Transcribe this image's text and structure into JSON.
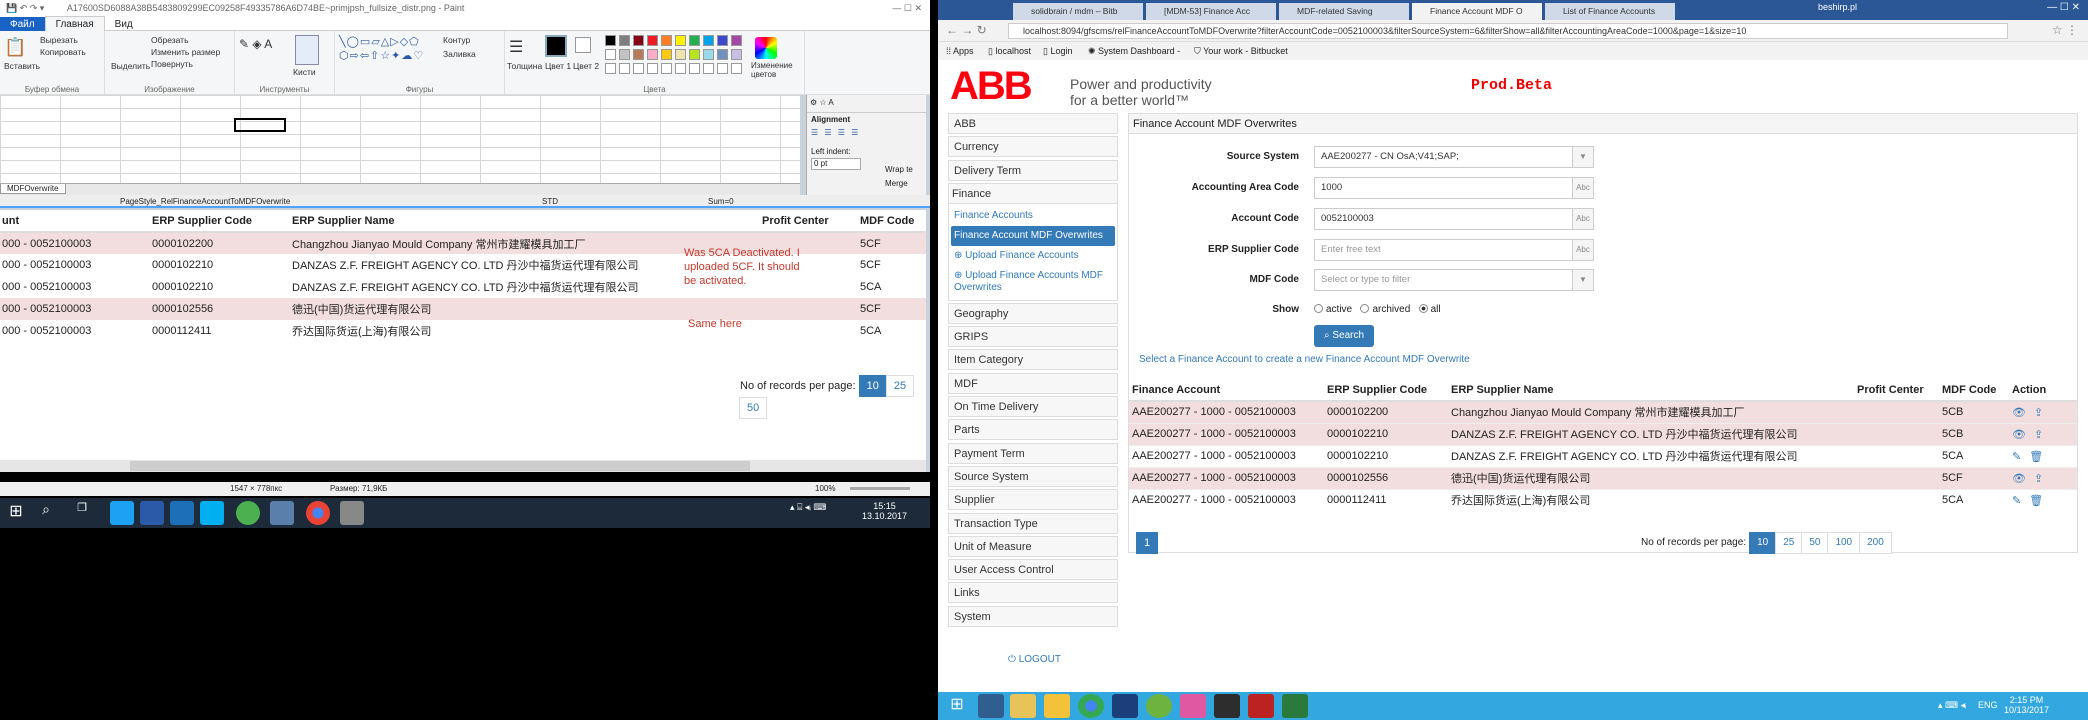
{
  "paint": {
    "title": "A17600SD6088A38B5483809299EC09258F49335786A6D74BE~primjpsh_fullsize_distr.png - Paint",
    "tabs": [
      "Файл",
      "Главная",
      "Вид"
    ],
    "ribbon": {
      "paste": "Вставить",
      "cut": "Вырезать",
      "copy": "Копировать",
      "select": "Выделить",
      "crop": "Обрезать",
      "resize": "Изменить размер",
      "rotate": "Повернуть",
      "brushes": "Кисти",
      "outline": "Контур",
      "fill": "Заливка",
      "size": "Толщина",
      "color1": "Цвет 1",
      "color2": "Цвет 2",
      "edit_colors": "Изменение цветов",
      "groups": [
        "Буфер обмена",
        "Изображение",
        "Инструменты",
        "Фигуры",
        "Цвета"
      ]
    },
    "sheet_tab": "MDFOverwrite",
    "page_style": "PageStyle_RelFinanceAccountToMDFOverwrite",
    "std": "STD",
    "sum": "Sum=0",
    "align_panel": {
      "title": "Alignment",
      "left_indent": "Left indent:",
      "indent_val": "0 pt",
      "wrap": "Wrap te",
      "merge": "Merge"
    },
    "table": {
      "headers": [
        "unt",
        "ERP Supplier Code",
        "ERP Supplier Name",
        "Profit Center",
        "MDF Code"
      ],
      "rows": [
        {
          "acct": "000 - 0052100003",
          "code": "0000102200",
          "name": "Changzhou Jianyao Mould Company 常州市建耀模具加工厂",
          "mdf": "5CF",
          "pink": true
        },
        {
          "acct": "000 - 0052100003",
          "code": "0000102210",
          "name": "DANZAS Z.F. FREIGHT AGENCY CO. LTD 丹沙中福货运代理有限公司",
          "mdf": "5CF",
          "pink": false
        },
        {
          "acct": "000 - 0052100003",
          "code": "0000102210",
          "name": "DANZAS Z.F. FREIGHT AGENCY CO. LTD 丹沙中福货运代理有限公司",
          "mdf": "5CA",
          "pink": false
        },
        {
          "acct": "000 - 0052100003",
          "code": "0000102556",
          "name": "德迅(中国)货运代理有限公司",
          "mdf": "5CF",
          "pink": true
        },
        {
          "acct": "000 - 0052100003",
          "code": "0000112411",
          "name": "乔达国际货运(上海)有限公司",
          "mdf": "5CA",
          "pink": false
        }
      ],
      "note1": "Was 5CA Deactivated. I uploaded 5CF. It should be activated.",
      "note2": "Same here",
      "records_label": "No of records per page:",
      "pages": [
        "10",
        "25",
        "50"
      ]
    },
    "status": {
      "dims": "1547 × 778пкс",
      "size": "Размер: 71,9КБ",
      "zoom": "100%"
    },
    "clock": {
      "time": "15:15",
      "date": "13.10.2017"
    }
  },
  "browser": {
    "tabs": [
      "solidbrain / mdm – Bitb",
      "[MDM-53] Finance Acc",
      "MDF-related Saving",
      "Finance Account MDF O",
      "List of Finance Accounts"
    ],
    "user": "beshirp.pl",
    "url": "localhost:8094/gfscms/relFinanceAccountToMDFOverwrite?filterAccountCode=0052100003&filterSourceSystem=6&filterShow=all&filterAccountingAreaCode=1000&page=1&size=10",
    "bookmarks": [
      "Apps",
      "localhost",
      "Login",
      "System Dashboard -",
      "Your work - Bitbucket"
    ],
    "logo": "ABB",
    "tagline1": "Power and productivity",
    "tagline2": "for a better world™",
    "env": "Prod.Beta",
    "nav_top": [
      "ABB",
      "Currency",
      "Delivery Term"
    ],
    "nav_group": {
      "header": "Finance",
      "items": [
        "Finance Accounts",
        "Finance Account MDF Overwrites",
        "Upload Finance Accounts",
        "Upload Finance Accounts MDF Overwrites"
      ]
    },
    "nav_bottom": [
      "Geography",
      "GRIPS",
      "Item Category",
      "MDF",
      "On Time Delivery",
      "Parts",
      "Payment Term",
      "Source System",
      "Supplier",
      "Transaction Type",
      "Unit of Measure",
      "User Access Control",
      "Links",
      "System"
    ],
    "logout": "LOGOUT",
    "panel_title": "Finance Account MDF Overwrites",
    "form": {
      "source_label": "Source System",
      "source_val": "AAE200277 - CN OsA;V41;SAP;",
      "area_label": "Accounting Area Code",
      "area_val": "1000",
      "account_label": "Account Code",
      "account_val": "0052100003",
      "erp_label": "ERP Supplier Code",
      "erp_ph": "Enter free text",
      "mdf_label": "MDF Code",
      "mdf_ph": "Select or type to filter",
      "show_label": "Show",
      "show_opts": [
        "active",
        "archived",
        "all"
      ],
      "search": "Search",
      "abc": "Abc"
    },
    "hint": "Select a Finance Account to create a new Finance Account MDF Overwrite",
    "table": {
      "headers": [
        "Finance Account",
        "ERP Supplier Code",
        "ERP Supplier Name",
        "Profit Center",
        "MDF Code",
        "Action"
      ],
      "rows": [
        {
          "acct": "AAE200277 - 1000 - 0052100003",
          "code": "0000102200",
          "name": "Changzhou Jianyao Mould Company 常州市建耀模具加工厂",
          "mdf": "5CB",
          "pink": true,
          "icons": [
            "eye-icon",
            "upload-icon"
          ]
        },
        {
          "acct": "AAE200277 - 1000 - 0052100003",
          "code": "0000102210",
          "name": "DANZAS Z.F. FREIGHT AGENCY CO. LTD 丹沙中福货运代理有限公司",
          "mdf": "5CB",
          "pink": true,
          "icons": [
            "eye-icon",
            "upload-icon"
          ]
        },
        {
          "acct": "AAE200277 - 1000 - 0052100003",
          "code": "0000102210",
          "name": "DANZAS Z.F. FREIGHT AGENCY CO. LTD 丹沙中福货运代理有限公司",
          "mdf": "5CA",
          "pink": false,
          "icons": [
            "pencil-icon",
            "trash-icon"
          ]
        },
        {
          "acct": "AAE200277 - 1000 - 0052100003",
          "code": "0000102556",
          "name": "德迅(中国)货运代理有限公司",
          "mdf": "5CF",
          "pink": true,
          "icons": [
            "eye-icon",
            "upload-icon"
          ]
        },
        {
          "acct": "AAE200277 - 1000 - 0052100003",
          "code": "0000112411",
          "name": "乔达国际货运(上海)有限公司",
          "mdf": "5CA",
          "pink": false,
          "icons": [
            "pencil-icon",
            "trash-icon"
          ]
        }
      ],
      "page": "1",
      "records_label": "No of records per page:",
      "sizes": [
        "10",
        "25",
        "50",
        "100",
        "200"
      ]
    },
    "clock": {
      "lang": "ENG",
      "time": "2:15 PM",
      "date": "10/13/2017"
    }
  }
}
